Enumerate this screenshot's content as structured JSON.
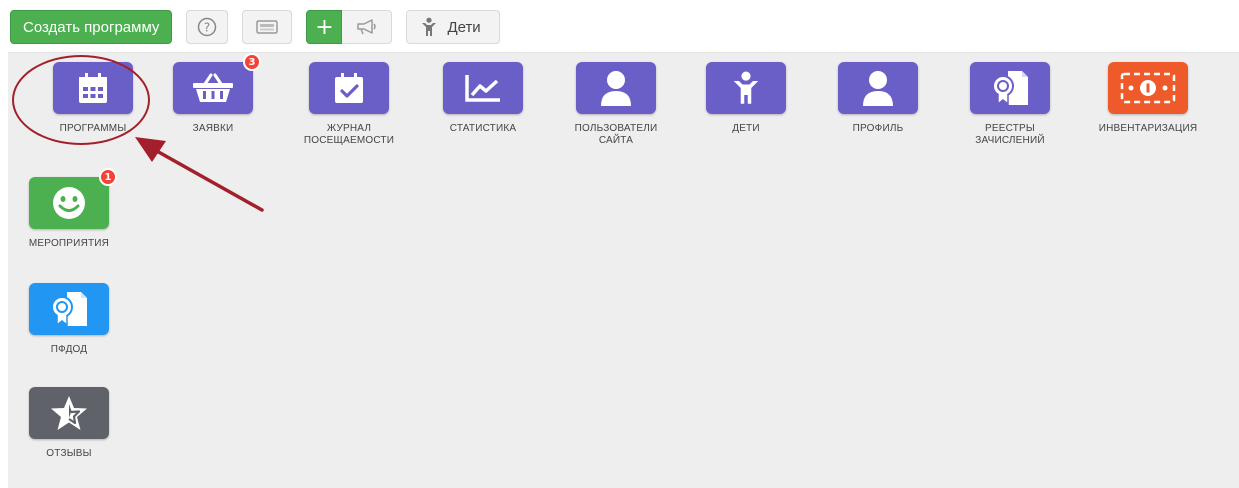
{
  "toolbar": {
    "create_program": "Создать программу",
    "kids_label": "Дети",
    "help_icon": "help-circle-icon",
    "print_icon": "print-icon",
    "plus_icon": "plus-icon",
    "announcement_icon": "megaphone-icon",
    "kids_icon": "child-icon",
    "colors": {
      "primary": "#4caf50"
    }
  },
  "tiles": {
    "programs": {
      "label": "ПРОГРАММЫ",
      "icon": "calendar-icon"
    },
    "requests": {
      "label": "ЗАЯВКИ",
      "icon": "basket-icon",
      "badge": "3"
    },
    "attendance": {
      "label": "ЖУРНАЛ\nПОСЕЩАЕМОСТИ",
      "icon": "calendar-check-icon"
    },
    "statistics": {
      "label": "СТАТИСТИКА",
      "icon": "chart-icon"
    },
    "site_users": {
      "label": "ПОЛЬЗОВАТЕЛИ\nСАЙТА",
      "icon": "user-icon"
    },
    "children": {
      "label": "ДЕТИ",
      "icon": "child-icon"
    },
    "profile": {
      "label": "ПРОФИЛЬ",
      "icon": "profile-icon"
    },
    "enrollment_registers": {
      "label": "РЕЕСТРЫ\nЗАЧИСЛЕНИЙ",
      "icon": "certificate-icon"
    },
    "inventory": {
      "label": "ИНВЕНТАРИЗАЦИЯ",
      "icon": "money-icon"
    },
    "events": {
      "label": "МЕРОПРИЯТИЯ",
      "icon": "smiley-icon",
      "badge": "1"
    },
    "pfdod": {
      "label": "ПФДОД",
      "icon": "certificate-icon"
    },
    "reviews": {
      "label": "ОТЗЫВЫ",
      "icon": "star-icon"
    }
  },
  "colors": {
    "tile_purple": "#6a5fc7",
    "tile_green": "#4caf50",
    "tile_blue": "#2196f3",
    "tile_gray": "#5f6268",
    "tile_orange": "#ee5a2a",
    "badge_red": "#f44336",
    "annotation": "#a31f2b"
  }
}
